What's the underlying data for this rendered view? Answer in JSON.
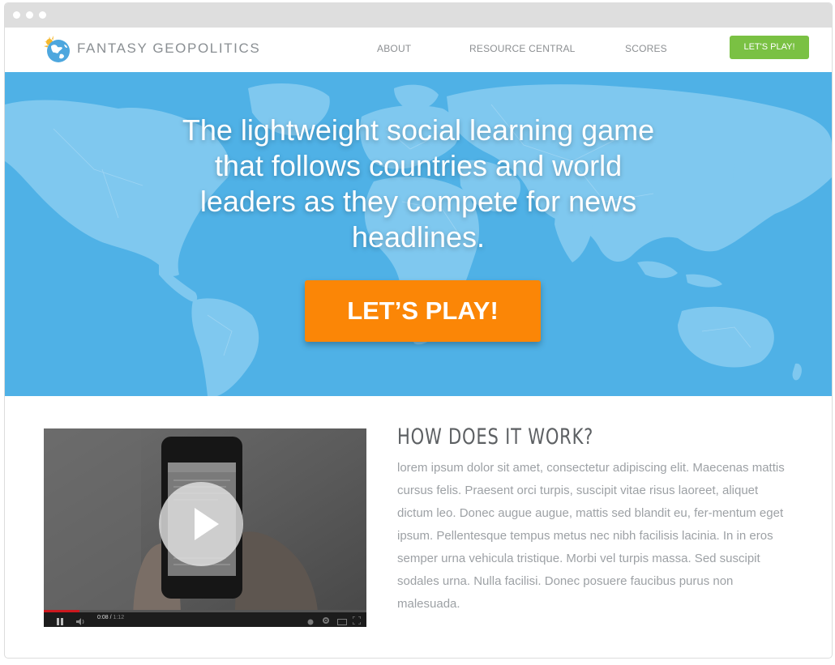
{
  "browser": {
    "window_dots": [
      "dot",
      "dot",
      "dot"
    ]
  },
  "header": {
    "brand": "FANTASY GEOPOLITICS",
    "logo_icon": "globe-icon",
    "nav": [
      {
        "label": "ABOUT"
      },
      {
        "label": "RESOURCE CENTRAL"
      },
      {
        "label": "SCORES"
      }
    ],
    "cta_label": "LET'S PLAY!"
  },
  "hero": {
    "headline": "The lightweight social learning game that follows countries and world leaders as they compete for news headlines.",
    "cta_label": "LET’S PLAY!",
    "background_icon": "world-map-illustration"
  },
  "video": {
    "play_icon": "play-icon",
    "time_current": "0:08",
    "time_total": "1:12",
    "progress": 0.11
  },
  "how_it_works": {
    "title": "HOW DOES IT WORK?",
    "body": "lorem ipsum dolor sit amet, consectetur adipiscing elit. Maecenas mattis cursus felis. Praesent orci turpis, suscipit vitae risus laoreet, aliquet dictum leo. Donec augue augue, mattis sed blandit eu, fer-mentum eget ipsum. Pellentesque tempus metus nec nibh facilisis lacinia. In in eros semper urna vehicula tristique. Morbi vel turpis massa. Sed suscipit sodales urna. Nulla facilisi. Donec posuere faucibus purus non malesuada."
  },
  "colors": {
    "hero_blue": "#4fb1e6",
    "map_land": "#7fc8ef",
    "nav_cta_green": "#7ac143",
    "hero_cta_orange": "#fb8606",
    "logo_blue": "#4ea7de",
    "logo_sun": "#f5b82e"
  }
}
